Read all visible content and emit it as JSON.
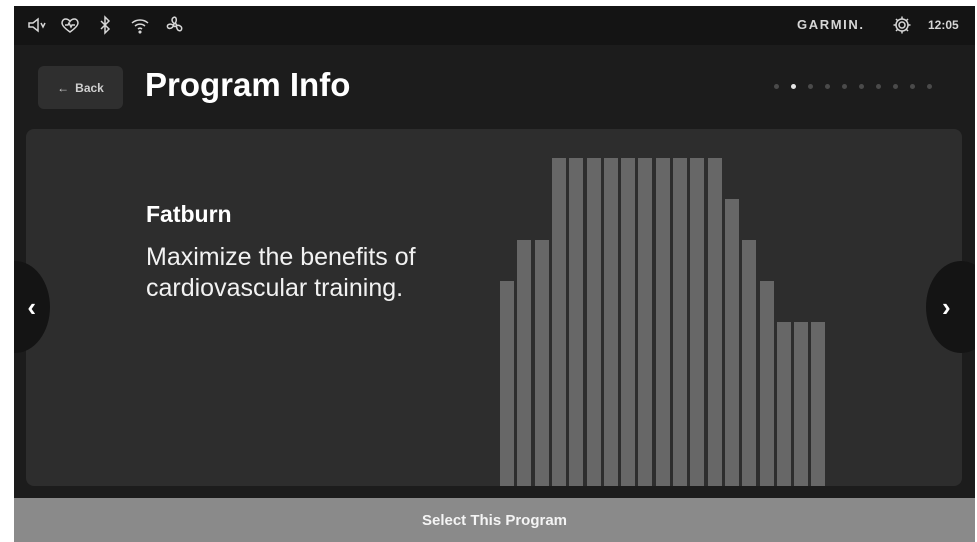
{
  "statusbar": {
    "icons": [
      "speaker-icon",
      "heart-rate-icon",
      "bluetooth-icon",
      "wifi-icon",
      "fan-icon"
    ],
    "brand": "GARMIN.",
    "clock": "12:05"
  },
  "header": {
    "back_label": "Back",
    "title": "Program Info",
    "page_count": 10,
    "active_page": 2
  },
  "program": {
    "name": "Fatburn",
    "description": "Maximize the benefits of cardiovascular training.",
    "profile_levels": [
      5,
      6,
      6,
      8,
      8,
      8,
      8,
      8,
      8,
      8,
      8,
      8,
      8,
      7,
      6,
      5,
      4,
      4,
      4
    ]
  },
  "footer": {
    "select_label": "Select This Program"
  },
  "colors": {
    "background": "#1c1c1c",
    "card": "#2d2d2d",
    "bar": "#676767",
    "select_button": "#8a8a8a"
  }
}
